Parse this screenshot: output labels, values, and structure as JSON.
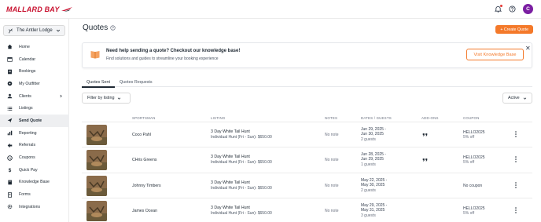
{
  "brand": {
    "logo_text": "MALLARD BAY",
    "logo_color": "#c8102e"
  },
  "topbar": {
    "avatar_initial": "C",
    "avatar_color": "#7b1fa2"
  },
  "sidebar": {
    "lodge_name": "The Antler Lodge",
    "items": [
      {
        "label": "Home",
        "icon": "home-icon",
        "active": false
      },
      {
        "label": "Calendar",
        "icon": "calendar-icon",
        "active": false
      },
      {
        "label": "Bookings",
        "icon": "bookings-icon",
        "active": false
      },
      {
        "label": "My Outfitter",
        "icon": "compass-icon",
        "active": false
      },
      {
        "label": "Clients",
        "icon": "users-icon",
        "active": false
      },
      {
        "label": "Listings",
        "icon": "list-icon",
        "active": false
      },
      {
        "label": "Send Quote",
        "icon": "send-icon",
        "active": true
      },
      {
        "label": "Reporting",
        "icon": "chart-icon",
        "active": false
      },
      {
        "label": "Referrals",
        "icon": "referral-icon",
        "active": false
      },
      {
        "label": "Coupons",
        "icon": "coupon-icon",
        "active": false
      },
      {
        "label": "Quick Pay",
        "icon": "dollar-icon",
        "active": false
      },
      {
        "label": "Knowledge Base",
        "icon": "book-icon",
        "active": false
      },
      {
        "label": "Forms",
        "icon": "forms-icon",
        "active": false
      },
      {
        "label": "Integrations",
        "icon": "gear-icon",
        "active": false
      }
    ]
  },
  "page": {
    "title": "Quotes",
    "create_label": "+ Create Quote",
    "accent": "#f4792a"
  },
  "banner": {
    "title": "Need help sending a quote? Checkout our knowledge base!",
    "subtitle": "Find solutions and guides to streamline your booking experience",
    "button_label": "Visit Knowledge Base",
    "close_label": "✕"
  },
  "tabs": [
    {
      "label": "Quotes Sent",
      "active": true
    },
    {
      "label": "Quotes Requests",
      "active": false
    }
  ],
  "filters": {
    "listing_label": "Filter by listing",
    "status_label": "Active"
  },
  "table": {
    "headers": {
      "sportsman": "SPORTSMAN",
      "listing": "LISTING",
      "notes": "NOTES",
      "dates": "DATES / GUESTS",
      "addons": "ADD-ONS",
      "coupon": "COUPON"
    },
    "rows": [
      {
        "sportsman": "Coco Pahl",
        "listing": "3 Day White Tail Hunt",
        "listing_detail": "Individual Hunt (Fri - Sun): $650.00",
        "notes": "No note",
        "date_start": "Jun 29, 2025 -",
        "date_end": "Jun 30, 2025",
        "guests": "2 guests",
        "has_addon": true,
        "coupon": "HELLO2025",
        "coupon_detail": "5% off"
      },
      {
        "sportsman": "CHris Greens",
        "listing": "3 Day White Tail Hunt",
        "listing_detail": "Individual Hunt (Fri - Sun): $650.00",
        "notes": "No note",
        "date_start": "Jun 28, 2025 -",
        "date_end": "Jun 29, 2025",
        "guests": "1 guests",
        "has_addon": true,
        "coupon": "HELLO2025",
        "coupon_detail": "5% off"
      },
      {
        "sportsman": "Johnny Timbers",
        "listing": "3 Day White Tail Hunt",
        "listing_detail": "Individual Hunt (Fri - Sun): $650.00",
        "notes": "No note",
        "date_start": "May 22, 2025 -",
        "date_end": "May 30, 2025",
        "guests": "2 guests",
        "has_addon": false,
        "coupon": "No coupon",
        "coupon_detail": ""
      },
      {
        "sportsman": "James Ocean",
        "listing": "3 Day White Tail Hunt",
        "listing_detail": "Individual Hunt (Fri - Sun): $650.00",
        "notes": "No note",
        "date_start": "May 29, 2025 -",
        "date_end": "May 31, 2025",
        "guests": "3 guests",
        "has_addon": false,
        "coupon": "HELLO2025",
        "coupon_detail": "5% off"
      }
    ]
  }
}
